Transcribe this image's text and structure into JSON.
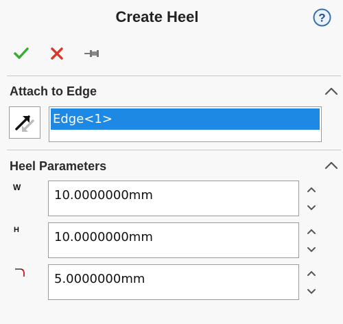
{
  "header": {
    "title": "Create Heel",
    "help_icon": "help-icon"
  },
  "toolbar": {
    "ok_icon": "checkmark-icon",
    "cancel_icon": "x-icon",
    "pin_icon": "pushpin-icon",
    "ok_color": "#3aa935",
    "cancel_color": "#d63a2a"
  },
  "attach": {
    "title": "Attach to Edge",
    "selector_icon": "edge-select-arrow-icon",
    "selected_item": "Edge<1>",
    "highlight_color": "#1e88e5"
  },
  "params": {
    "title": "Heel Parameters",
    "fields": [
      {
        "label": "W",
        "value": "10.0000000mm"
      },
      {
        "label": "H",
        "value": "10.0000000mm"
      },
      {
        "icon": "corner-radius-icon",
        "value": "5.0000000mm"
      }
    ]
  }
}
